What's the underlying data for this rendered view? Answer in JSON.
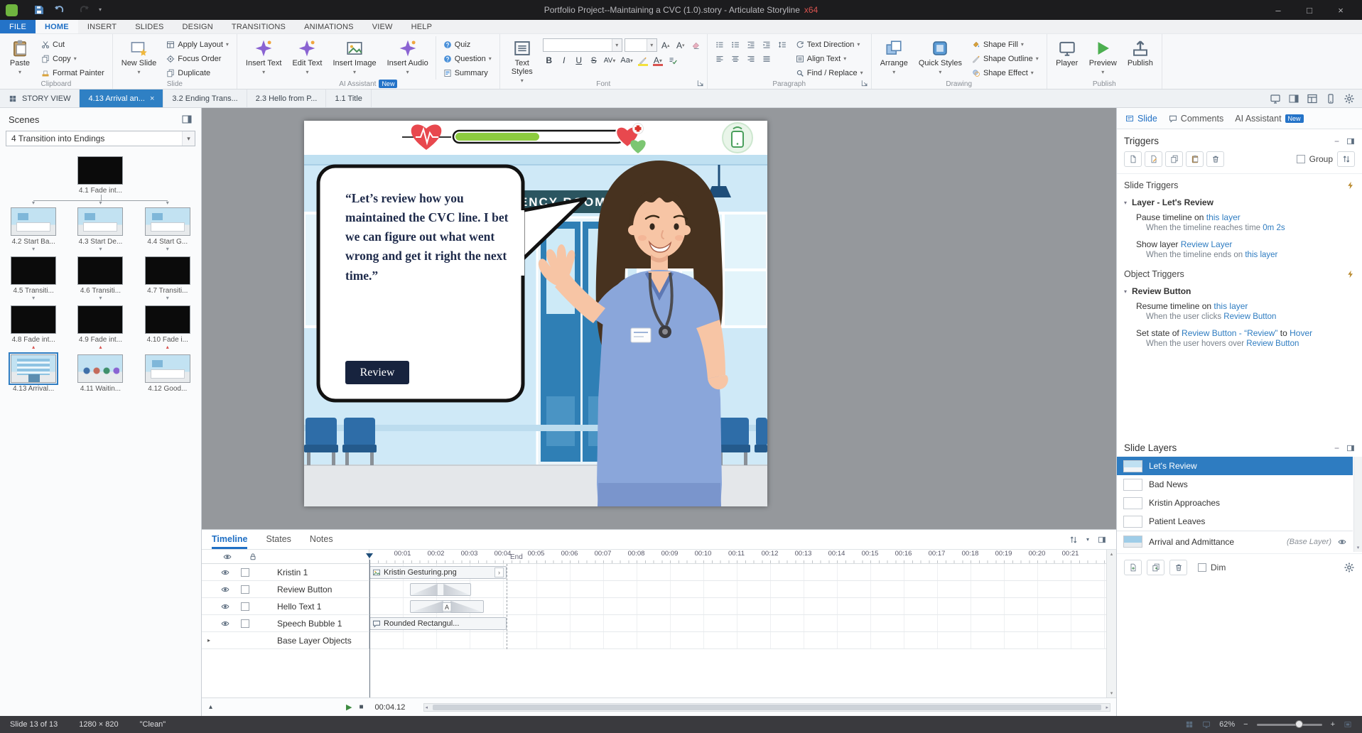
{
  "icons": {
    "caret": "▾",
    "close": "×",
    "minimize": "–",
    "maximize": "□",
    "chev_right": "›",
    "tri_down": "▼",
    "tri_up": "▲",
    "tri_sm_down": "▾",
    "tri_sm_up": "▴",
    "tri_sm_right": "▸",
    "play": "▶",
    "stop": "■",
    "plus": "+",
    "minus": "−",
    "arrow_left": "◂",
    "arrow_right": "▸",
    "letter_a": "A"
  },
  "titlebar": {
    "doc": "Portfolio Project--Maintaining a CVC (1.0).story",
    "sep": " -  ",
    "app": "Articulate Storyline",
    "arch": "x64"
  },
  "menu": {
    "file": "FILE",
    "home": "HOME",
    "insert": "INSERT",
    "slides": "SLIDES",
    "design": "DESIGN",
    "transitions": "TRANSITIONS",
    "animations": "ANIMATIONS",
    "view": "VIEW",
    "help": "HELP"
  },
  "ribbon": {
    "clipboard": {
      "label": "Clipboard",
      "paste": "Paste",
      "cut": "Cut",
      "copy": "Copy",
      "format_painter": "Format Painter"
    },
    "slide_group": {
      "label": "Slide",
      "new_slide": "New Slide",
      "apply_layout": "Apply Layout",
      "focus_order": "Focus Order",
      "duplicate": "Duplicate"
    },
    "ai": {
      "label": "AI Assistant",
      "badge": "New",
      "insert_text": "Insert Text",
      "edit_text": "Edit Text",
      "insert_image": "Insert Image",
      "insert_audio": "Insert Audio",
      "quiz": "Quiz",
      "question": "Question",
      "summary": "Summary"
    },
    "font": {
      "label": "Font",
      "text_styles": "Text Styles",
      "font_name": "",
      "font_size": "",
      "bold": "B",
      "italic": "I",
      "underline": "U",
      "strike": "S",
      "spacing": "AV",
      "case_btn": "Aa",
      "color_a": "A",
      "grow": "A",
      "shrink": "A"
    },
    "paragraph": {
      "label": "Paragraph",
      "text_direction": "Text Direction",
      "align_text": "Align Text",
      "find_replace": "Find / Replace"
    },
    "drawing": {
      "label": "Drawing",
      "arrange": "Arrange",
      "quick_styles": "Quick Styles",
      "shape_fill": "Shape Fill",
      "shape_outline": "Shape Outline",
      "shape_effect": "Shape Effect"
    },
    "publish": {
      "label": "Publish",
      "player": "Player",
      "preview": "Preview",
      "publish": "Publish"
    }
  },
  "doc_tabs": {
    "story_view": "STORY VIEW",
    "active": "4.13 Arrival an...",
    "t2": "3.2 Ending Trans...",
    "t3": "2.3 Hello from P...",
    "t4": "1.1 Title"
  },
  "scenes": {
    "title": "Scenes",
    "dropdown": "4 Transition into Endings",
    "s1": "4.1 Fade int...",
    "s2": "4.2 Start Ba...",
    "s3": "4.3 Start De...",
    "s4": "4.4 Start G...",
    "s5": "4.5 Transiti...",
    "s6": "4.6 Transiti...",
    "s7": "4.7 Transiti...",
    "s8": "4.8 Fade int...",
    "s9": "4.9 Fade int...",
    "s10": "4.10 Fade i...",
    "s11": "4.13 Arrival...",
    "s12": "4.11 Waitin...",
    "s13": "4.12 Good..."
  },
  "slide": {
    "sign": "EMERGENCY ROOM",
    "speech": "“Let’s review how you maintained the CVC line.  I bet we can figure out what went wrong and get it right the next time.”",
    "review": "Review"
  },
  "timeline": {
    "tab_timeline": "Timeline",
    "tab_states": "States",
    "tab_notes": "Notes",
    "r1": "Kristin 1",
    "r2": "Review Button",
    "r3": "Hello Text 1",
    "r4": "Speech Bubble 1",
    "r5": "Base Layer Objects",
    "bar1": "Kristin Gesturing.png",
    "bar4": "Rounded Rectangul...",
    "end": "End",
    "time": "00:04.12",
    "ticks": [
      "00:01",
      "00:02",
      "00:03",
      "00:04",
      "00:05",
      "00:06",
      "00:07",
      "00:08",
      "00:09",
      "00:10",
      "00:11",
      "00:12",
      "00:13",
      "00:14",
      "00:15",
      "00:16",
      "00:17",
      "00:18",
      "00:19",
      "00:20",
      "00:21"
    ]
  },
  "panel": {
    "tab_slide": "Slide",
    "tab_comments": "Comments",
    "tab_ai": "AI Assistant",
    "ai_badge": "New",
    "triggers": "Triggers",
    "group": "Group",
    "slide_triggers": "Slide Triggers",
    "layer_group": "Layer - Let's Review",
    "st1a1": "Pause timeline on ",
    "st1a2": "this layer",
    "st1w1": "When the timeline reaches time ",
    "st1w2": "0m 2s",
    "st2a1": "Show layer ",
    "st2a2": "Review Layer",
    "st2w1": "When the timeline ends on ",
    "st2w2": "this layer",
    "object_triggers": "Object Triggers",
    "object_group": "Review Button",
    "ot1a1": "Resume timeline on ",
    "ot1a2": "this layer",
    "ot1w1": "When the user clicks ",
    "ot1w2": "Review Button",
    "ot2a1": "Set state of ",
    "ot2a2": "Review Button - “Review”",
    "ot2a3": " to ",
    "ot2a4": "Hover",
    "ot2w1": "When the user hovers over ",
    "ot2w2": "Review Button",
    "slide_layers": "Slide Layers",
    "l1": "Let's Review",
    "l2": "Bad News",
    "l3": "Kristin Approaches",
    "l4": "Patient Leaves",
    "l5": "Arrival and Admittance",
    "base_tag": "(Base Layer)",
    "dim": "Dim"
  },
  "status": {
    "slide_info": "Slide 13 of 13",
    "dims": "1280 × 820",
    "theme": "\"Clean\"",
    "zoom": "62%"
  }
}
